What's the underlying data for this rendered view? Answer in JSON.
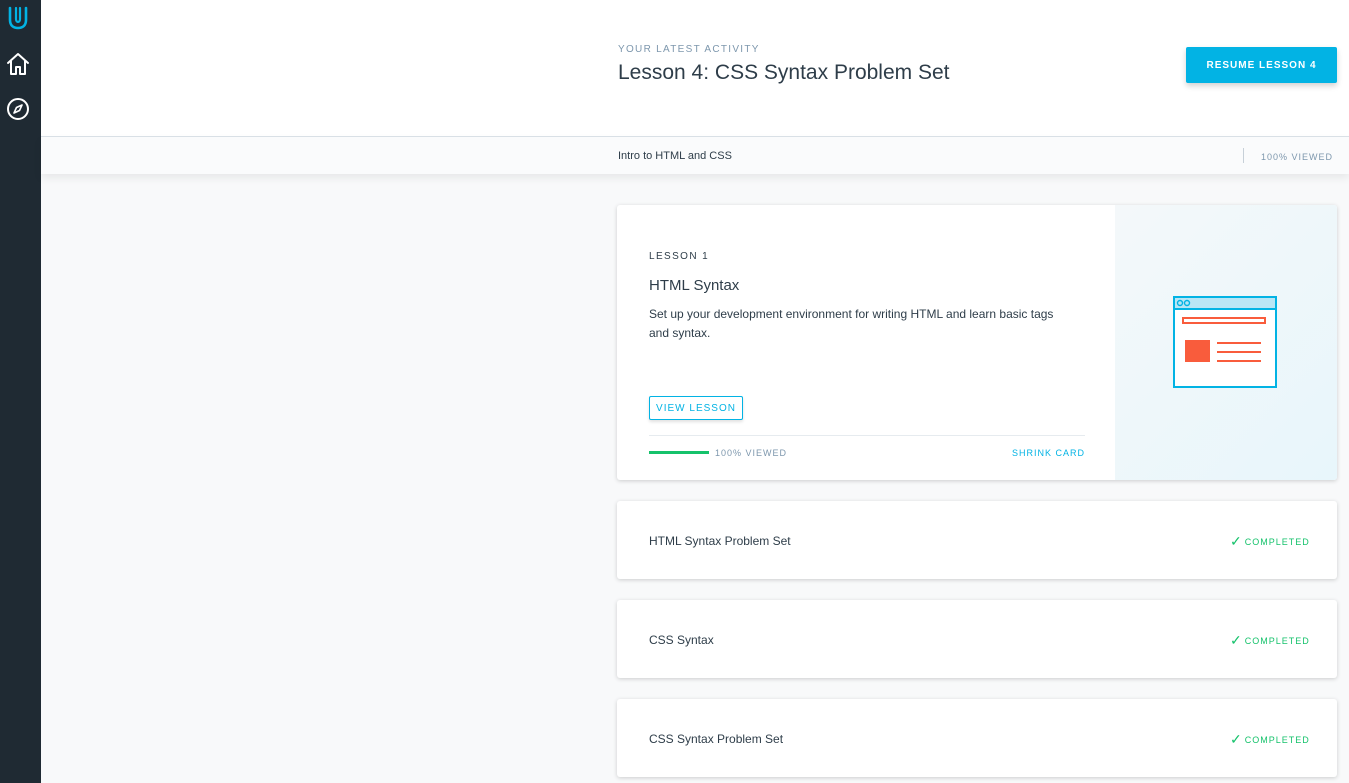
{
  "sidebar": {
    "items": [
      {
        "icon": "udacity-logo-icon"
      },
      {
        "icon": "home-icon"
      },
      {
        "icon": "compass-icon"
      }
    ]
  },
  "header": {
    "eyebrow": "YOUR LATEST ACTIVITY",
    "title": "Lesson 4: CSS Syntax Problem Set",
    "resume_label": "RESUME LESSON 4"
  },
  "course": {
    "name": "Intro to HTML and CSS",
    "viewed": "100% VIEWED"
  },
  "lesson_card": {
    "label": "LESSON 1",
    "title": "HTML Syntax",
    "description": "Set up your development environment for writing HTML and learn basic tags and syntax.",
    "view_label": "VIEW LESSON",
    "progress": 1.0,
    "viewed": "100% VIEWED",
    "shrink_label": "SHRINK CARD",
    "illustration": "browser-window-icon"
  },
  "lessons": [
    {
      "title": "HTML Syntax Problem Set",
      "status": "COMPLETED"
    },
    {
      "title": "CSS Syntax",
      "status": "COMPLETED"
    },
    {
      "title": "CSS Syntax Problem Set",
      "status": "COMPLETED"
    }
  ],
  "colors": {
    "sidebar": "#1f2a33",
    "accent": "#02b3e4",
    "success": "#15c26b",
    "illustration_red": "#f95c3c"
  }
}
